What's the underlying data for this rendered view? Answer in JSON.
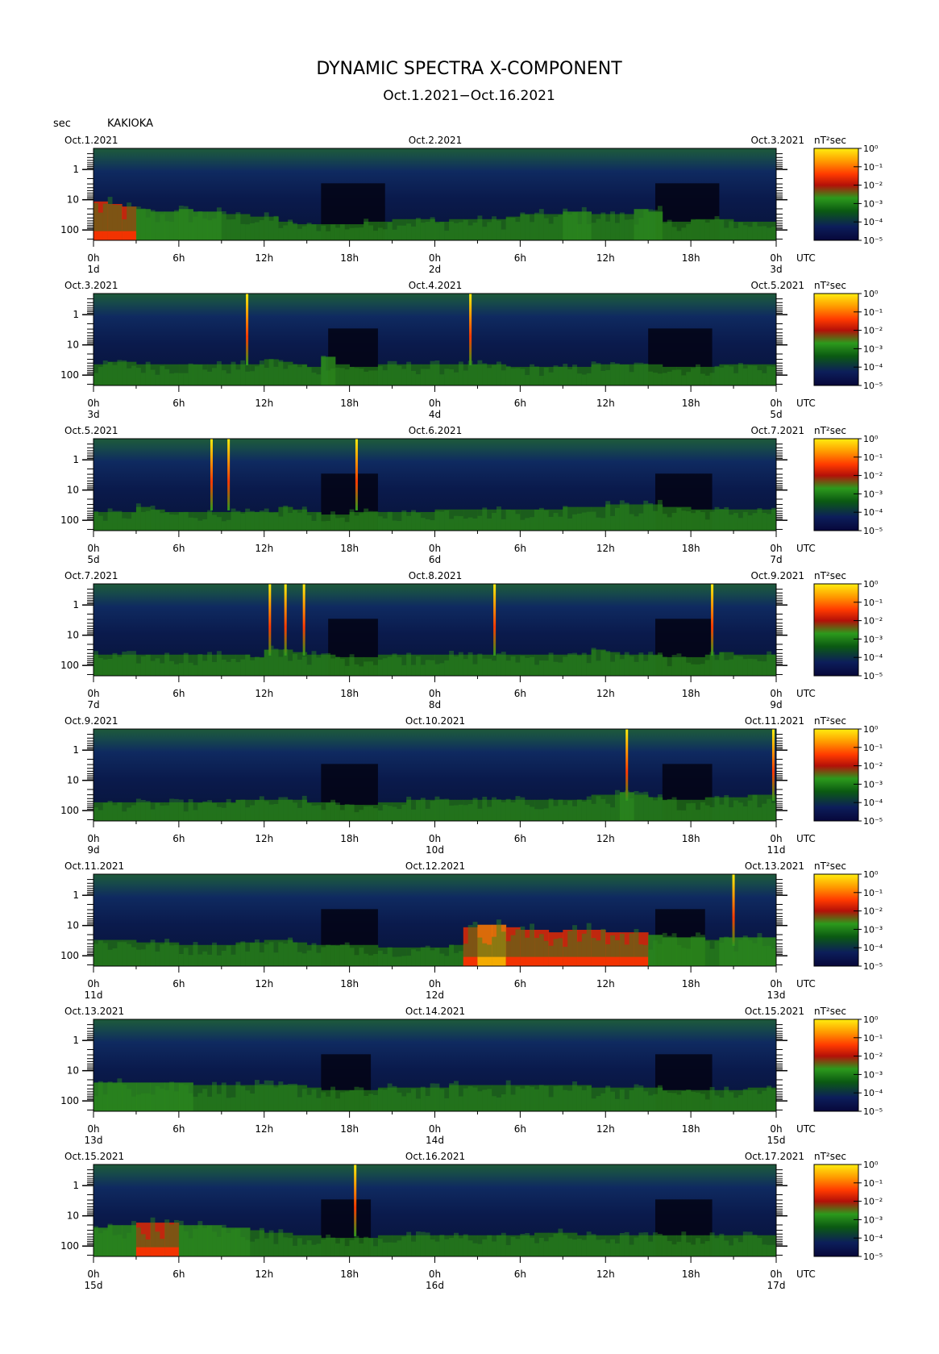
{
  "title": "DYNAMIC SPECTRA X-COMPONENT",
  "subtitle": "Oct.1.2021−Oct.16.2021",
  "y_unit_label": "sec",
  "station": "KAKIOKA",
  "colorbar_unit": "nT²sec",
  "colors": {
    "scale": [
      "#07073a",
      "#0c1e5a",
      "#0b5a12",
      "#2c9a1c",
      "#b41008",
      "#ff3a00",
      "#ff9a00",
      "#ffee10"
    ]
  },
  "chart_data": {
    "type": "heatmap",
    "xlabel": "UTC",
    "ylabel": "sec",
    "y_scale": "log",
    "y_ticks": [
      "1",
      "10",
      "100"
    ],
    "x_ticks": [
      "0h",
      "6h",
      "12h",
      "18h",
      "0h",
      "6h",
      "12h",
      "18h",
      "0h"
    ],
    "colorbar": {
      "unit": "nT²sec",
      "ticks": [
        "10⁰",
        "10⁻¹",
        "10⁻²",
        "10⁻³",
        "10⁻⁴",
        "10⁻⁵"
      ]
    },
    "panels": [
      {
        "start_date": "Oct.1.2021",
        "mid_date": "Oct.2.2021",
        "end_date": "Oct.3.2021",
        "day_labels": [
          "1d",
          "2d",
          "3d"
        ],
        "spikes": [],
        "quiet_windows": [
          [
            16.0,
            20.5
          ],
          [
            39.5,
            44.0
          ]
        ],
        "activity": [
          0.55,
          0.5,
          0.45,
          0.4,
          0.35,
          0.35,
          0.4,
          0.35,
          0.35,
          0.3,
          0.3,
          0.25,
          0.25,
          0.15,
          0.1,
          0.1,
          0.1,
          0.1,
          0.1,
          0.15,
          0.15,
          0.2,
          0.2,
          0.2,
          0.15,
          0.2,
          0.2,
          0.2,
          0.2,
          0.25,
          0.3,
          0.3,
          0.3,
          0.35,
          0.35,
          0.3,
          0.3,
          0.3,
          0.4,
          0.35,
          0.15,
          0.15,
          0.2,
          0.2,
          0.2,
          0.15,
          0.15,
          0.15
        ]
      },
      {
        "start_date": "Oct.3.2021",
        "mid_date": "Oct.4.2021",
        "end_date": "Oct.5.2021",
        "day_labels": [
          "3d",
          "4d",
          "5d"
        ],
        "spikes": [
          10.8,
          26.5
        ],
        "quiet_windows": [
          [
            16.5,
            20.0
          ],
          [
            39.0,
            43.5
          ]
        ],
        "activity": [
          0.2,
          0.25,
          0.25,
          0.2,
          0.2,
          0.2,
          0.2,
          0.2,
          0.2,
          0.2,
          0.2,
          0.2,
          0.3,
          0.25,
          0.2,
          0.15,
          0.35,
          0.2,
          0.15,
          0.15,
          0.2,
          0.2,
          0.2,
          0.2,
          0.2,
          0.2,
          0.2,
          0.2,
          0.2,
          0.15,
          0.15,
          0.15,
          0.15,
          0.15,
          0.15,
          0.2,
          0.2,
          0.2,
          0.2,
          0.2,
          0.15,
          0.15,
          0.15,
          0.15,
          0.2,
          0.2,
          0.2,
          0.2
        ]
      },
      {
        "start_date": "Oct.5.2021",
        "mid_date": "Oct.6.2021",
        "end_date": "Oct.7.2021",
        "day_labels": [
          "5d",
          "6d",
          "7d"
        ],
        "spikes": [
          8.3,
          9.5,
          18.5
        ],
        "quiet_windows": [
          [
            16.0,
            20.0
          ],
          [
            39.5,
            43.5
          ]
        ],
        "activity": [
          0.15,
          0.15,
          0.15,
          0.25,
          0.2,
          0.15,
          0.15,
          0.15,
          0.15,
          0.15,
          0.15,
          0.15,
          0.15,
          0.25,
          0.2,
          0.15,
          0.1,
          0.1,
          0.15,
          0.15,
          0.15,
          0.15,
          0.15,
          0.15,
          0.2,
          0.2,
          0.2,
          0.2,
          0.2,
          0.2,
          0.2,
          0.2,
          0.2,
          0.25,
          0.25,
          0.25,
          0.3,
          0.3,
          0.3,
          0.3,
          0.25,
          0.25,
          0.2,
          0.2,
          0.2,
          0.2,
          0.2,
          0.2
        ]
      },
      {
        "start_date": "Oct.7.2021",
        "mid_date": "Oct.8.2021",
        "end_date": "Oct.9.2021",
        "day_labels": [
          "7d",
          "8d",
          "9d"
        ],
        "spikes": [
          12.4,
          13.5,
          14.8,
          28.2,
          43.5
        ],
        "quiet_windows": [
          [
            16.5,
            20.0
          ],
          [
            39.5,
            43.5
          ]
        ],
        "activity": [
          0.2,
          0.2,
          0.2,
          0.2,
          0.2,
          0.2,
          0.2,
          0.2,
          0.2,
          0.2,
          0.2,
          0.15,
          0.3,
          0.3,
          0.25,
          0.2,
          0.2,
          0.15,
          0.15,
          0.15,
          0.2,
          0.2,
          0.2,
          0.2,
          0.2,
          0.2,
          0.2,
          0.2,
          0.2,
          0.2,
          0.2,
          0.2,
          0.2,
          0.2,
          0.2,
          0.3,
          0.25,
          0.2,
          0.2,
          0.2,
          0.15,
          0.15,
          0.15,
          0.2,
          0.25,
          0.2,
          0.2,
          0.2
        ]
      },
      {
        "start_date": "Oct.9.2021",
        "mid_date": "Oct.10.2021",
        "end_date": "Oct.11.2021",
        "day_labels": [
          "9d",
          "10d",
          "11d"
        ],
        "spikes": [
          37.5,
          47.8
        ],
        "quiet_windows": [
          [
            16.0,
            20.0
          ],
          [
            40.0,
            43.5
          ]
        ],
        "activity": [
          0.15,
          0.15,
          0.15,
          0.15,
          0.15,
          0.15,
          0.15,
          0.15,
          0.15,
          0.15,
          0.2,
          0.2,
          0.2,
          0.2,
          0.2,
          0.15,
          0.15,
          0.1,
          0.1,
          0.1,
          0.15,
          0.15,
          0.2,
          0.2,
          0.2,
          0.2,
          0.2,
          0.2,
          0.2,
          0.2,
          0.2,
          0.2,
          0.2,
          0.2,
          0.2,
          0.3,
          0.3,
          0.35,
          0.3,
          0.25,
          0.2,
          0.2,
          0.2,
          0.25,
          0.25,
          0.25,
          0.3,
          0.3
        ]
      },
      {
        "start_date": "Oct.11.2021",
        "mid_date": "Oct.12.2021",
        "end_date": "Oct.13.2021",
        "day_labels": [
          "11d",
          "12d",
          "13d"
        ],
        "spikes": [
          45.0
        ],
        "quiet_windows": [
          [
            16.0,
            20.0
          ],
          [
            39.5,
            43.0
          ]
        ],
        "activity": [
          0.3,
          0.3,
          0.3,
          0.25,
          0.25,
          0.25,
          0.2,
          0.2,
          0.2,
          0.2,
          0.25,
          0.25,
          0.3,
          0.3,
          0.25,
          0.2,
          0.2,
          0.2,
          0.2,
          0.2,
          0.15,
          0.15,
          0.15,
          0.15,
          0.15,
          0.2,
          0.55,
          0.6,
          0.6,
          0.55,
          0.5,
          0.5,
          0.45,
          0.5,
          0.5,
          0.5,
          0.45,
          0.45,
          0.45,
          0.4,
          0.35,
          0.35,
          0.35,
          0.3,
          0.35,
          0.35,
          0.35,
          0.35
        ]
      },
      {
        "start_date": "Oct.13.2021",
        "mid_date": "Oct.14.2021",
        "end_date": "Oct.15.2021",
        "day_labels": [
          "13d",
          "14d",
          "15d"
        ],
        "spikes": [],
        "quiet_windows": [
          [
            16.0,
            19.5
          ],
          [
            39.5,
            43.5
          ]
        ],
        "activity": [
          0.35,
          0.35,
          0.35,
          0.35,
          0.35,
          0.35,
          0.35,
          0.3,
          0.3,
          0.3,
          0.3,
          0.3,
          0.3,
          0.3,
          0.3,
          0.25,
          0.2,
          0.2,
          0.2,
          0.2,
          0.25,
          0.25,
          0.25,
          0.25,
          0.25,
          0.3,
          0.3,
          0.3,
          0.3,
          0.3,
          0.3,
          0.3,
          0.3,
          0.3,
          0.3,
          0.25,
          0.25,
          0.25,
          0.25,
          0.25,
          0.2,
          0.2,
          0.2,
          0.2,
          0.2,
          0.2,
          0.25,
          0.25
        ]
      },
      {
        "start_date": "Oct.15.2021",
        "mid_date": "Oct.16.2021",
        "end_date": "Oct.17.2021",
        "day_labels": [
          "15d",
          "16d",
          "17d"
        ],
        "spikes": [
          18.4
        ],
        "quiet_windows": [
          [
            16.0,
            19.5
          ],
          [
            39.5,
            43.5
          ]
        ],
        "activity": [
          0.35,
          0.4,
          0.4,
          0.45,
          0.45,
          0.45,
          0.4,
          0.4,
          0.4,
          0.35,
          0.35,
          0.3,
          0.25,
          0.25,
          0.2,
          0.2,
          0.15,
          0.15,
          0.15,
          0.15,
          0.2,
          0.2,
          0.2,
          0.2,
          0.2,
          0.2,
          0.2,
          0.2,
          0.2,
          0.2,
          0.2,
          0.25,
          0.25,
          0.25,
          0.2,
          0.2,
          0.2,
          0.2,
          0.2,
          0.2,
          0.2,
          0.2,
          0.2,
          0.2,
          0.2,
          0.2,
          0.2,
          0.2
        ]
      }
    ]
  }
}
